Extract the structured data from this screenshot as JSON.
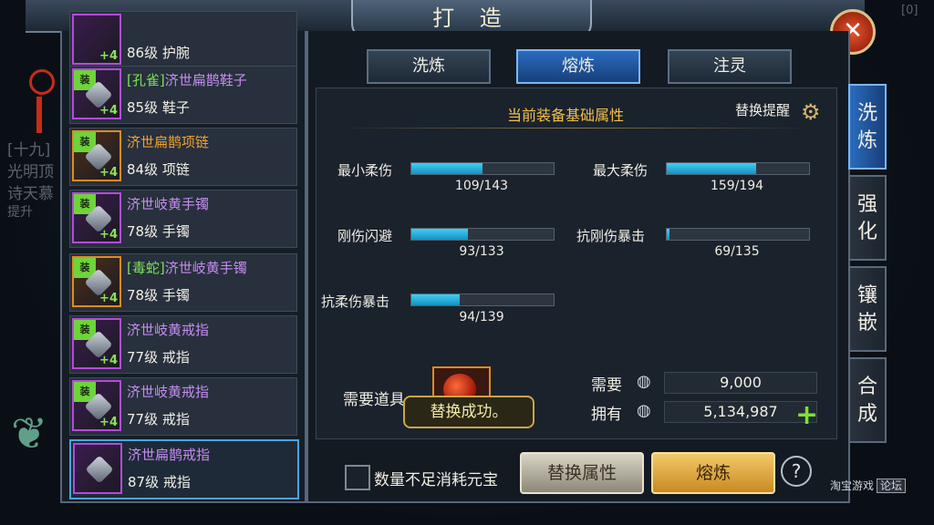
{
  "window": {
    "title": "打 造",
    "close_symbol": "✕"
  },
  "item_list": [
    {
      "tag": "",
      "name": "",
      "level": "86级 护腕",
      "plus": "+4",
      "quality": "purple",
      "name_color": "purple"
    },
    {
      "tag": "装",
      "name_prefix": "[孔雀]",
      "name": "济世扁鹊鞋子",
      "level": "85级 鞋子",
      "plus": "+4",
      "quality": "purple",
      "name_color": "purple"
    },
    {
      "tag": "装",
      "name_prefix": "",
      "name": "济世扁鹊项链",
      "level": "84级 项链",
      "plus": "+4",
      "quality": "orange",
      "name_color": "orange"
    },
    {
      "tag": "装",
      "name_prefix": "",
      "name": "济世岐黄手镯",
      "level": "78级 手镯",
      "plus": "+4",
      "quality": "purple",
      "name_color": "purple"
    },
    {
      "tag": "装",
      "name_prefix": "[毒蛇]",
      "name": "济世岐黄手镯",
      "level": "78级 手镯",
      "plus": "+4",
      "quality": "orange",
      "name_color": "purple"
    },
    {
      "tag": "装",
      "name_prefix": "",
      "name": "济世岐黄戒指",
      "level": "77级 戒指",
      "plus": "+4",
      "quality": "purple",
      "name_color": "purple"
    },
    {
      "tag": "装",
      "name_prefix": "",
      "name": "济世岐黄戒指",
      "level": "77级 戒指",
      "plus": "+4",
      "quality": "purple",
      "name_color": "purple"
    },
    {
      "tag": "",
      "name_prefix": "",
      "name": "济世扁鹊戒指",
      "level": "87级 戒指",
      "plus": "",
      "quality": "purple",
      "name_color": "purple",
      "selected": true
    }
  ],
  "tabs": [
    {
      "label": "洗炼",
      "active": false
    },
    {
      "label": "熔炼",
      "active": true
    },
    {
      "label": "注灵",
      "active": false
    }
  ],
  "attributes": {
    "title": "当前装备基础属性",
    "swap_remind": "替换提醒",
    "stats": [
      {
        "label": "最小柔伤",
        "value": "109/143",
        "ratio": 0.5
      },
      {
        "label": "最大柔伤",
        "value": "159/194",
        "ratio": 0.63
      },
      {
        "label": "刚伤闪避",
        "value": "93/133",
        "ratio": 0.4
      },
      {
        "label": "抗刚伤暴击",
        "value": "69/135",
        "ratio": 0.02
      },
      {
        "label": "抗柔伤暴击",
        "value": "94/139",
        "ratio": 0.34
      }
    ]
  },
  "requirements": {
    "need_item_label": "需要道具",
    "need_label": "需要",
    "need_value": "9,000",
    "have_label": "拥有",
    "have_value": "5,134,987",
    "add_symbol": "+"
  },
  "toast": "替换成功。",
  "footer": {
    "checkbox_label": "数量不足消耗元宝",
    "replace_button": "替换属性",
    "smelt_button": "熔炼",
    "help_symbol": "?"
  },
  "side_tabs": [
    {
      "label": "洗\n炼",
      "active": true
    },
    {
      "label": "强\n化",
      "active": false
    },
    {
      "label": "镶\n嵌",
      "active": false
    },
    {
      "label": "合\n成",
      "active": false
    }
  ],
  "background_text": {
    "left_lines": [
      "[十九]",
      "光明顶",
      "诗天慕",
      "提升"
    ],
    "top_right": "[0]"
  },
  "watermark": {
    "text": "淘宝游戏",
    "badge": "论坛"
  }
}
